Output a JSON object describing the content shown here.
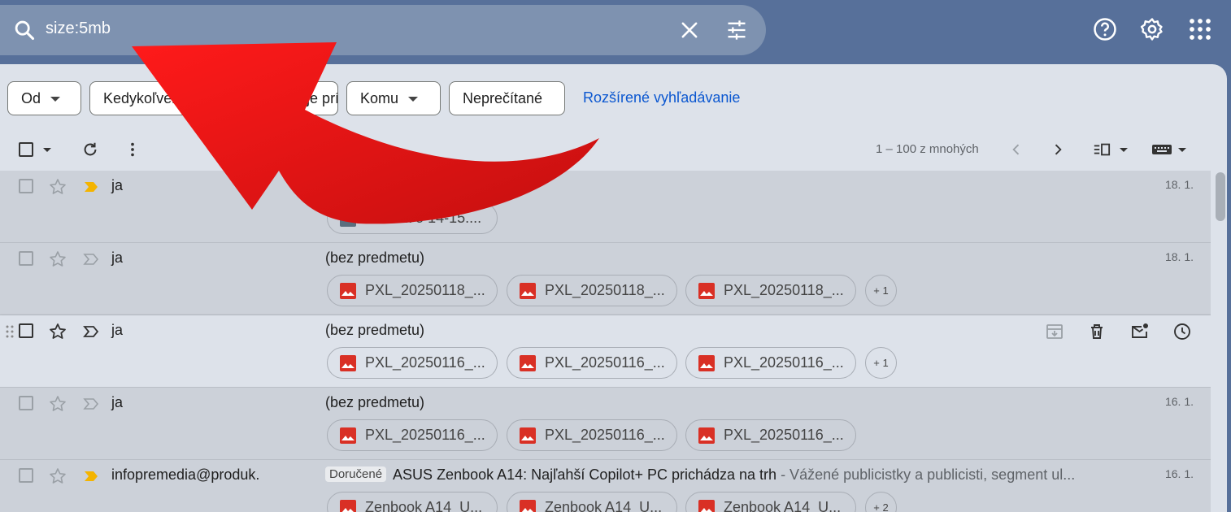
{
  "search": {
    "query": "size:5mb"
  },
  "filters": {
    "from": "Od",
    "any_time": "Kedykoľvek",
    "attachment": "Obsahuje prílohu",
    "to": "Komu",
    "unread": "Neprečítané",
    "advanced": "Rozšírené vyhľadávanie"
  },
  "pager": {
    "text": "1 – 100 z mnohých"
  },
  "rows": [
    {
      "sender": "ja",
      "subject": "",
      "date": "18. 1.",
      "attachments": [
        "Sobota o 14-15...."
      ]
    },
    {
      "sender": "ja",
      "subject": "(bez predmetu)",
      "date": "18. 1.",
      "attachments": [
        "PXL_20250118_...",
        "PXL_20250118_...",
        "PXL_20250118_..."
      ],
      "more": "+ 1"
    },
    {
      "sender": "ja",
      "subject": "(bez predmetu)",
      "date": "",
      "attachments": [
        "PXL_20250116_...",
        "PXL_20250116_...",
        "PXL_20250116_..."
      ],
      "more": "+ 1"
    },
    {
      "sender": "ja",
      "subject": "(bez predmetu)",
      "date": "16. 1.",
      "attachments": [
        "PXL_20250116_...",
        "PXL_20250116_...",
        "PXL_20250116_..."
      ]
    },
    {
      "sender": "infopremedia@produk.",
      "label": "Doručené",
      "subject": "ASUS Zenbook A14: Najľahší Copilot+ PC prichádza na trh",
      "snippet": " - Vážené publicistky a publicisti, segment ul...",
      "date": "16. 1.",
      "attachments": [
        "Zenbook A14_U...",
        "Zenbook A14_U...",
        "Zenbook A14_U..."
      ],
      "more": "+ 2"
    }
  ],
  "icons": {
    "search": "search-icon",
    "clear": "close-icon",
    "tune": "tune-icon",
    "help": "help-icon",
    "settings": "gear-icon",
    "apps": "apps-grid-icon",
    "annotation": "red-curved-arrow"
  },
  "colors": {
    "topbar": "#57709a",
    "panel": "#dde2ea",
    "link": "#0b57d0",
    "arrow": "#e00000"
  }
}
